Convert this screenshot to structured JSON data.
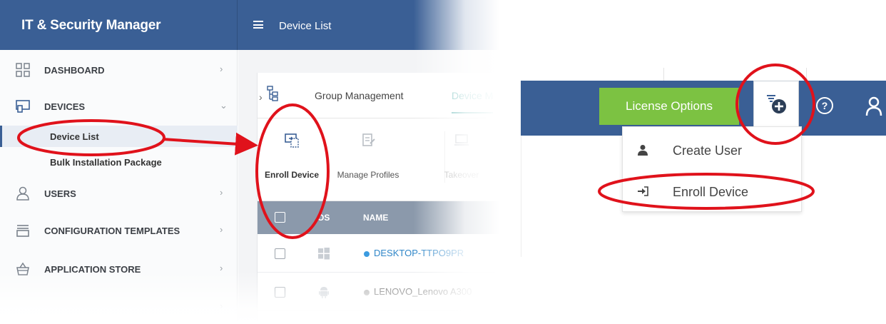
{
  "app": {
    "brand_title": "IT & Security Manager",
    "page_title": "Device List"
  },
  "sidebar": {
    "items": [
      {
        "label": "DASHBOARD",
        "icon": "dashboard-grid-icon",
        "chevron": "›"
      },
      {
        "label": "DEVICES",
        "icon": "devices-icon",
        "chevron": "⌄",
        "expanded": true
      },
      {
        "label": "USERS",
        "icon": "user-icon",
        "chevron": "›"
      },
      {
        "label": "CONFIGURATION TEMPLATES",
        "icon": "templates-icon",
        "chevron": "›"
      },
      {
        "label": "APPLICATION STORE",
        "icon": "store-basket-icon",
        "chevron": "›"
      },
      {
        "label": "",
        "icon": "",
        "chevron": "›"
      }
    ],
    "sub_items": [
      {
        "label": "Device List",
        "active": true
      },
      {
        "label": "Bulk Installation Package",
        "active": false
      }
    ]
  },
  "tabs": {
    "toggle": "›",
    "group": "Group Management",
    "device": "Device M"
  },
  "toolbar": {
    "enroll": "Enroll Device",
    "manage": "Manage Profiles",
    "takeover": "Takeover"
  },
  "table": {
    "headers": {
      "os": "OS",
      "name": "NAME"
    },
    "rows": [
      {
        "os": "windows-icon",
        "name": "DESKTOP-TTPO9PR",
        "status_color": "#3b9be0",
        "name_color": "#2f86c8"
      },
      {
        "os": "android-icon",
        "name": "LENOVO_Lenovo A300",
        "status_color": "#a9a9a9",
        "name_color": "#555555"
      }
    ]
  },
  "right_panel": {
    "license_label": "License Options",
    "help_glyph": "?",
    "menu": [
      {
        "label": "Create User",
        "icon": "user-icon"
      },
      {
        "label": "Enroll Device",
        "icon": "sign-in-icon"
      }
    ]
  },
  "colors": {
    "header_blue": "#3a5f95",
    "license_green": "#7cc242",
    "annotation_red": "#e0121b",
    "tab_teal": "#3aa3a0"
  }
}
